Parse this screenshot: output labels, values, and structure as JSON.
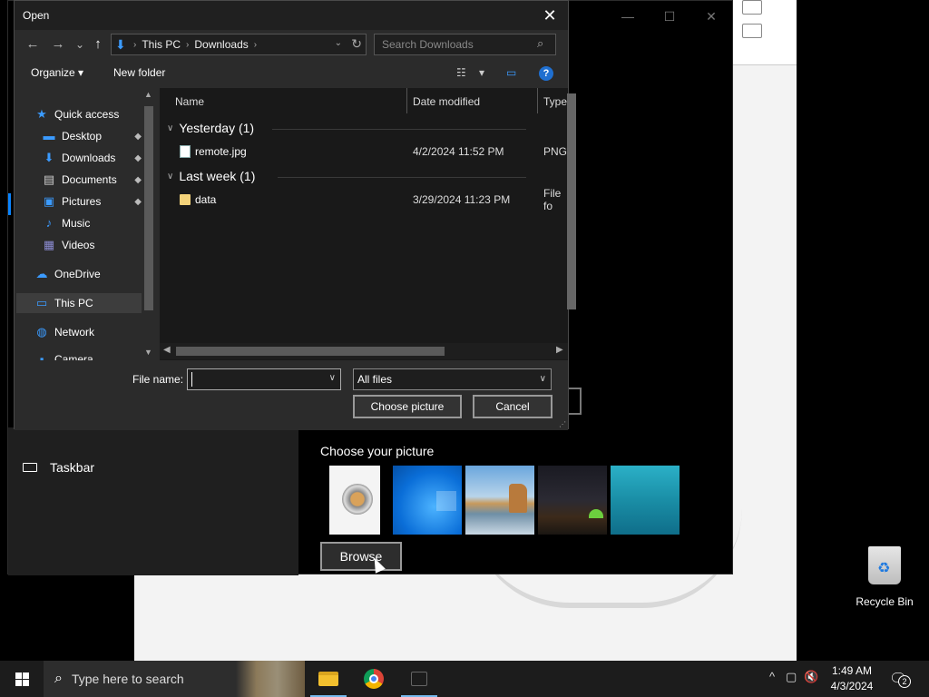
{
  "dialog": {
    "title": "Open",
    "close_glyph": "✕",
    "nav": {
      "back_icon": "arrow-left-icon",
      "forward_icon": "arrow-right-icon",
      "recent_icon": "chevron-down-icon",
      "up_icon": "arrow-up-icon",
      "back_glyph": "←",
      "forward_glyph": "→",
      "recent_glyph": "⌄",
      "up_glyph": "↑"
    },
    "address": {
      "crumbs": [
        "This PC",
        "Downloads"
      ],
      "separator": "›",
      "refresh_glyph": "↻",
      "dropdown_glyph": "⌄",
      "location_glyph": "⬇"
    },
    "search": {
      "placeholder": "Search Downloads",
      "icon_glyph": "⌕"
    },
    "toolbar": {
      "organize_label": "Organize",
      "organize_arrow": "▾",
      "new_folder_label": "New folder",
      "view_glyph": "☷",
      "view_arrow": "▾",
      "preview_glyph": "▭",
      "help_glyph": "?"
    },
    "navpane": {
      "items": [
        {
          "label": "Quick access",
          "icon": "star-icon",
          "glyph": "★",
          "color": "#3b9bff",
          "pinned": false
        },
        {
          "label": "Desktop",
          "icon": "desktop-icon",
          "glyph": "▬",
          "color": "#3b9bff",
          "pinned": true
        },
        {
          "label": "Downloads",
          "icon": "download-icon",
          "glyph": "⬇",
          "color": "#3b9bff",
          "pinned": true
        },
        {
          "label": "Documents",
          "icon": "document-icon",
          "glyph": "▤",
          "color": "#cccccc",
          "pinned": true
        },
        {
          "label": "Pictures",
          "icon": "pictures-icon",
          "glyph": "▣",
          "color": "#3b9bff",
          "pinned": true
        },
        {
          "label": "Music",
          "icon": "music-icon",
          "glyph": "♪",
          "color": "#3b9bff",
          "pinned": false
        },
        {
          "label": "Videos",
          "icon": "videos-icon",
          "glyph": "▦",
          "color": "#8a8ad0",
          "pinned": false
        },
        {
          "label": "OneDrive",
          "icon": "cloud-icon",
          "glyph": "☁",
          "color": "#3b9bff",
          "pinned": false
        },
        {
          "label": "This PC",
          "icon": "computer-icon",
          "glyph": "▭",
          "color": "#3b9bff",
          "pinned": false,
          "selected": true
        },
        {
          "label": "Network",
          "icon": "network-icon",
          "glyph": "◍",
          "color": "#3b9bff",
          "pinned": false
        },
        {
          "label": "Camera",
          "icon": "camera-icon",
          "glyph": "▪",
          "color": "#3b9bff",
          "pinned": false
        }
      ],
      "pin_glyph": "📌"
    },
    "columns": {
      "name": "Name",
      "date": "Date modified",
      "type": "Type"
    },
    "groups": [
      {
        "label": "Yesterday (1)",
        "files": [
          {
            "name": "remote.jpg",
            "date": "4/2/2024 11:52 PM",
            "type": "PNG",
            "kind": "image"
          }
        ]
      },
      {
        "label": "Last week (1)",
        "files": [
          {
            "name": "data",
            "date": "3/29/2024 11:23 PM",
            "type": "File fo",
            "kind": "folder"
          }
        ]
      }
    ],
    "file_name_label": "File name:",
    "file_name_value": "",
    "filter_value": "All files",
    "choose_label": "Choose picture",
    "cancel_label": "Cancel"
  },
  "settings": {
    "taskbar_label": "Taskbar",
    "choose_heading": "Choose your picture",
    "browse_label": "Browse",
    "thumbs": [
      "washer",
      "windows-blue",
      "beach",
      "night-sky",
      "ocean"
    ],
    "window_controls": [
      "—",
      "☐",
      "✕"
    ]
  },
  "desktop": {
    "recycle_bin_label": "Recycle Bin"
  },
  "taskbar": {
    "search_placeholder": "Type here to search",
    "search_glyph": "⌕",
    "time": "1:49 AM",
    "date": "4/3/2024",
    "notification_count": "2",
    "tray_glyphs": {
      "show_hidden": "^",
      "tablet": "▢",
      "volume": "🔇"
    },
    "notif_glyph": "🗨"
  }
}
